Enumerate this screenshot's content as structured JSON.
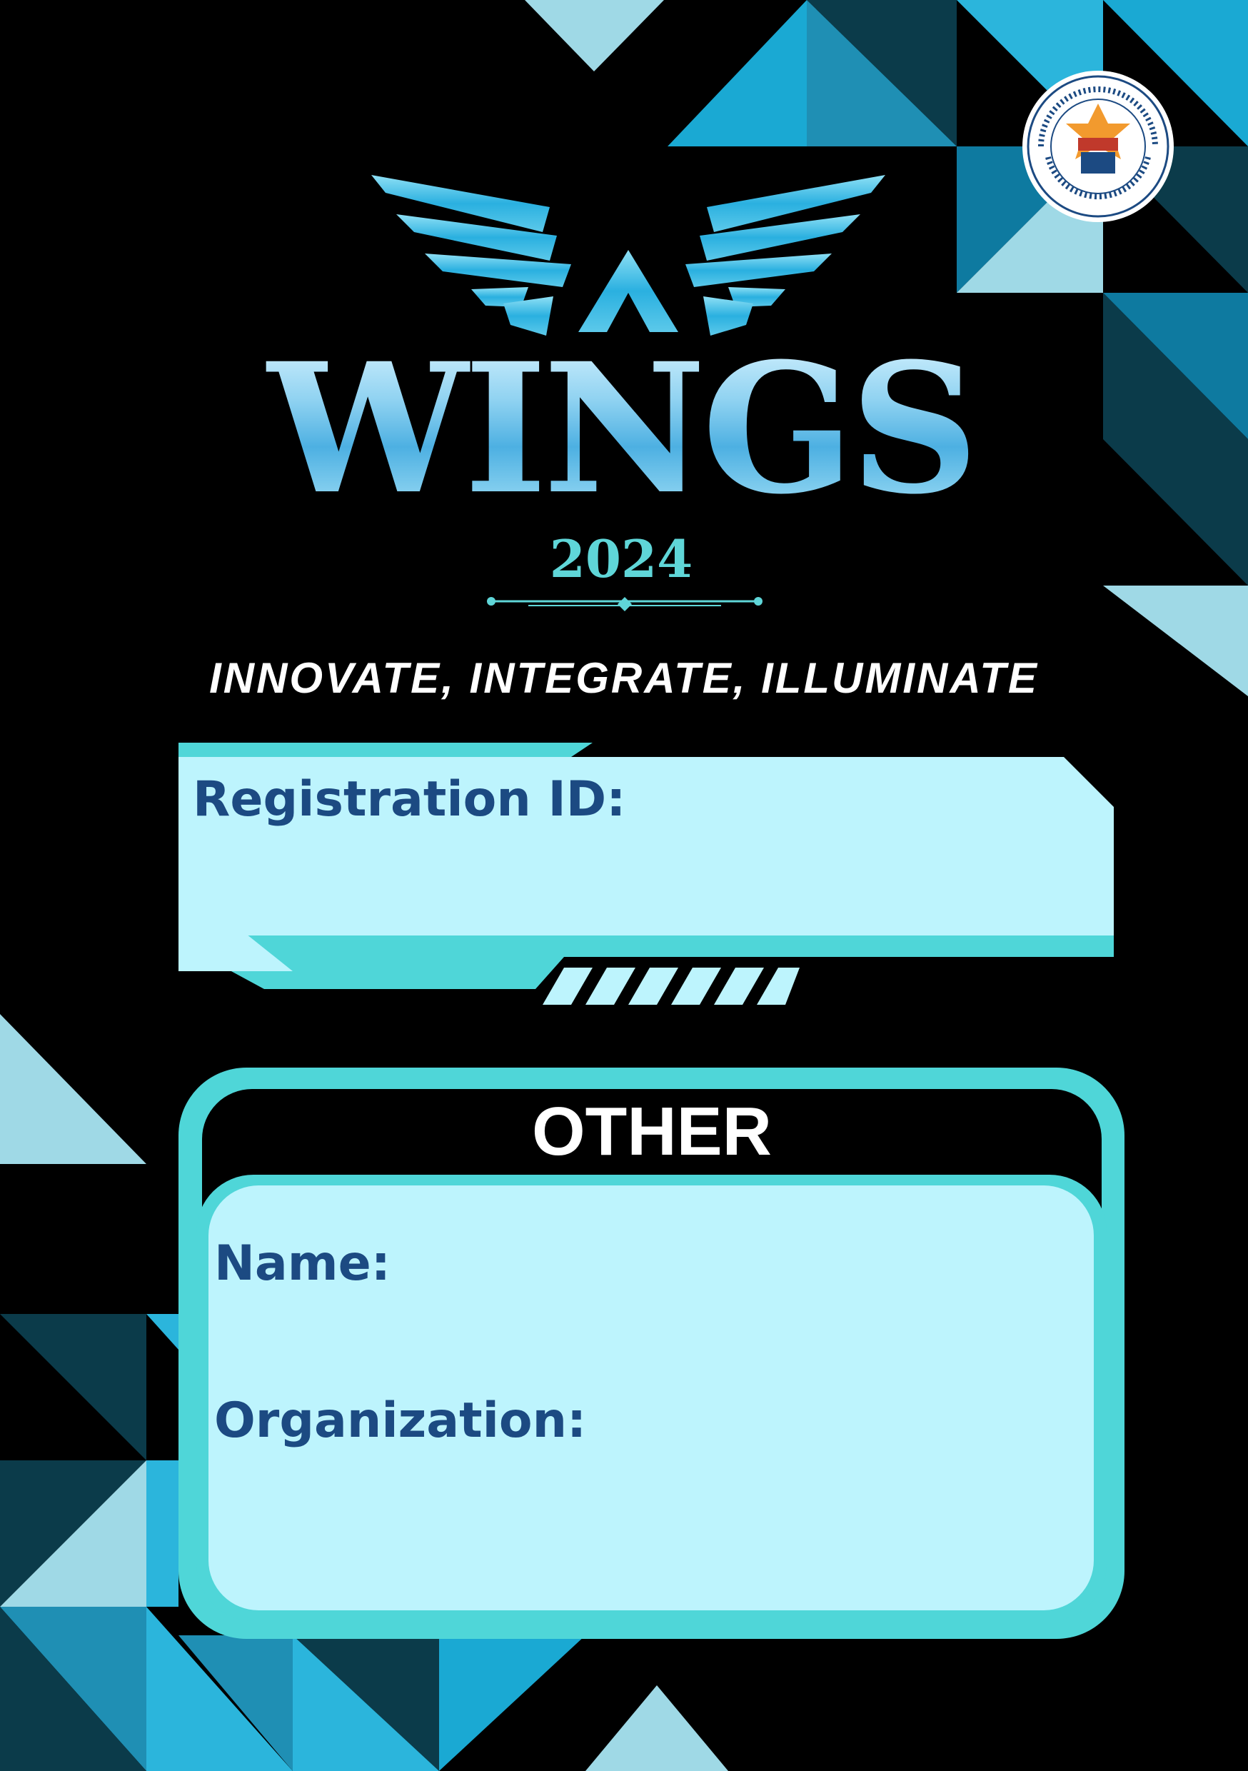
{
  "event": {
    "title": "WINGS",
    "year": "2024",
    "tagline": "INNOVATE, INTEGRATE, ILLUMINATE"
  },
  "institution_logo": {
    "icon": "college-seal-icon",
    "seal_text": "GOVERNMENT COLLEGE OF ENGINEERING CHHATRAPATI SAMBHAJINAGAR",
    "badge": "GECCS"
  },
  "registration": {
    "label": "Registration ID:",
    "value": ""
  },
  "category": {
    "label": "OTHER",
    "fields": [
      {
        "label": "Name:",
        "value": ""
      },
      {
        "label": "Organization:",
        "value": ""
      }
    ]
  },
  "colors": {
    "background": "#000000",
    "panel_light": "#bdf4fd",
    "accent_teal": "#4fd6d8",
    "label_blue": "#1c4a82",
    "triangle_dark": "#0b3b4a",
    "triangle_mid": "#1f9fc8",
    "triangle_light": "#9fd9e6"
  }
}
